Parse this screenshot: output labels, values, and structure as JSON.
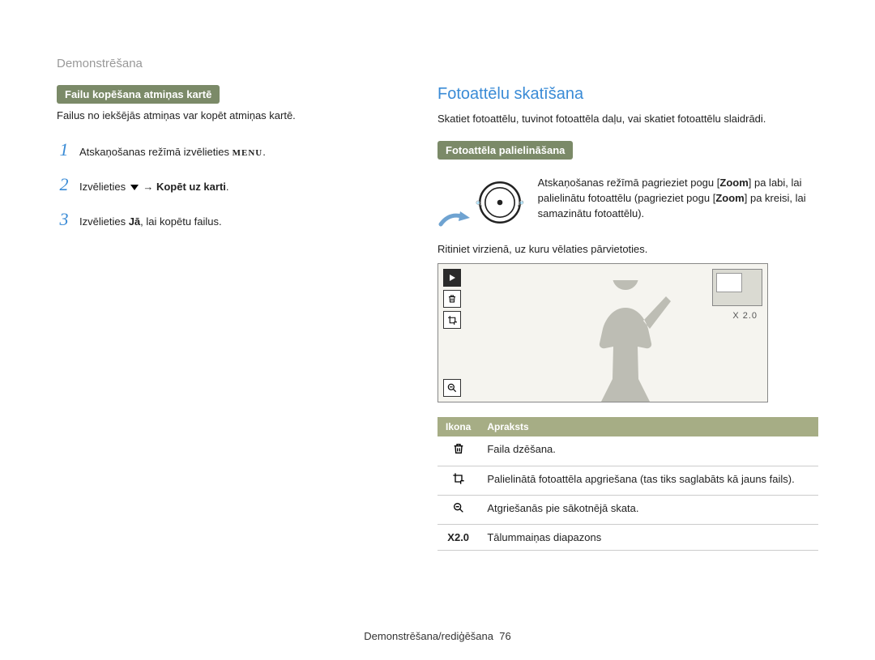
{
  "header": "Demonstrēšana",
  "left": {
    "section_head": "Failu kopēšana atmiņas kartē",
    "subtext": "Failus no iekšējās atmiņas var kopēt atmiņas kartē.",
    "steps": {
      "s1": {
        "num": "1",
        "pre": "Atskaņošanas režīmā izvēlieties ",
        "glyph": "MENU",
        "post": "."
      },
      "s2": {
        "num": "2",
        "pre": "Izvēlieties ",
        "arrow": "↓",
        "sep": " → ",
        "bold": "Kopēt uz karti",
        "post": "."
      },
      "s3": {
        "num": "3",
        "pre": "Izvēlieties ",
        "bold": "Jā",
        "post": ", lai kopētu failus."
      }
    }
  },
  "right": {
    "title": "Fotoattēlu skatīšana",
    "intro": "Skatiet fotoattēlu, tuvinot fotoattēla daļu, vai skatiet fotoattēlu slaidrādi.",
    "section_head": "Fotoattēla palielināšana",
    "zoom_text_a": "Atskaņošanas režīmā pagrieziet pogu [",
    "zoom_bold1": "Zoom",
    "zoom_text_b": "] pa labi, lai palielinātu fotoattēlu (pagrieziet pogu [",
    "zoom_bold2": "Zoom",
    "zoom_text_c": "] pa kreisi, lai samazinātu fotoattēlu).",
    "scroll_hint": "Ritiniet virzienā, uz kuru vēlaties pārvietoties.",
    "zoom_label": "X 2.0",
    "table": {
      "h1": "Ikona",
      "h2": "Apraksts",
      "r1_desc": "Faila dzēšana.",
      "r2_desc": "Palielinātā fotoattēla apgriešana (tas tiks saglabāts kā jauns fails).",
      "r3_desc": "Atgriešanās pie sākotnējā skata.",
      "r4_icon": "X2.0",
      "r4_desc": "Tālummaiņas diapazons"
    }
  },
  "footer": {
    "text": "Demonstrēšana/rediģēšana",
    "page": "76"
  },
  "icons": {
    "trash": "trash-icon",
    "crop": "crop-icon",
    "magnify": "magnify-icon",
    "play": "play-icon",
    "dial": "zoom-dial"
  }
}
